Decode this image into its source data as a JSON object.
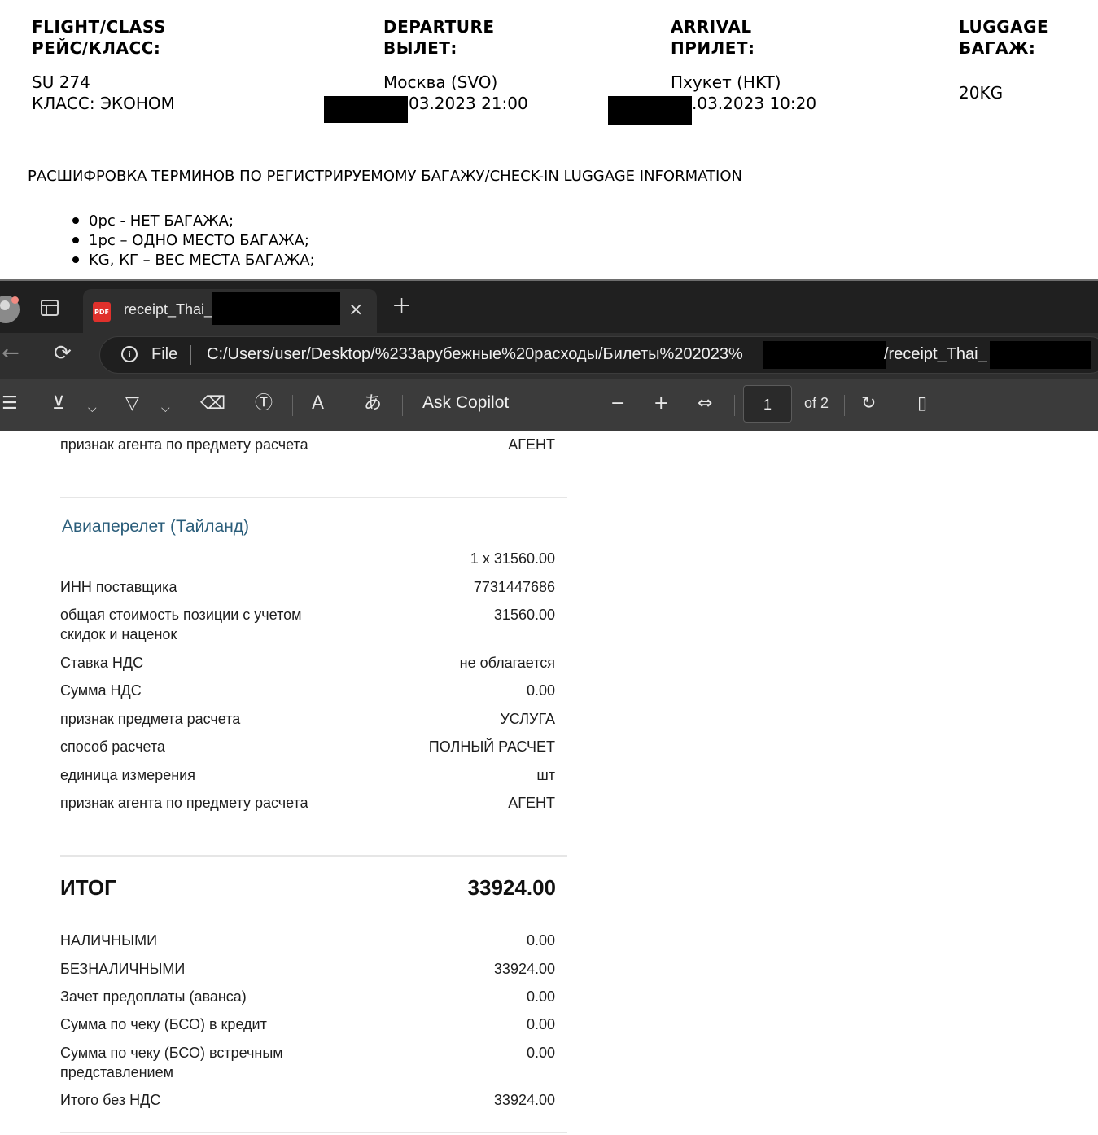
{
  "ticket": {
    "flight": {
      "header_en": "FLIGHT/CLASS",
      "header_ru": "РЕЙС/КЛАСС:",
      "line1": "SU 274",
      "line2": "КЛАСС: ЭКОНОМ"
    },
    "departure": {
      "header_en": "DEPARTURE",
      "header_ru": "ВЫЛЕТ:",
      "line1": "Москва (SVO)",
      "line2": "03.2023 21:00"
    },
    "arrival": {
      "header_en": "ARRIVAL",
      "header_ru": "ПРИЛЕТ:",
      "line1": "Пхукет (HKT)",
      "line2": ".03.2023 10:20"
    },
    "luggage": {
      "header_en": "LUGGAGE",
      "header_ru": "БАГАЖ:",
      "value": "20KG"
    },
    "terms_title": "РАСШИФРОВКА ТЕРМИНОВ ПО РЕГИСТРИРУЕМОМУ БАГАЖУ/CHECK-IN LUGGAGE INFORMATION",
    "terms": [
      "0pc - НЕТ БАГАЖА;",
      "1pc – ОДНО МЕСТО БАГАЖА;",
      "KG, КГ – ВЕС МЕСТА БАГАЖА;"
    ]
  },
  "browser": {
    "tab_title": "receipt_Thai_S",
    "address_scheme": "File",
    "address_url": "C:/Users/user/Desktop/%233арубежные%20расходы/Билеты%202023%",
    "address_url_tail": "/receipt_Thai_",
    "icons": {
      "close": "×",
      "new_tab": "+",
      "back": "←",
      "reload": "⟳",
      "info": "i",
      "menu": "☰",
      "highlight": "⊻",
      "draw": "▽",
      "dropdown": "⌵",
      "eraser": "⌫",
      "text_box": "Ⓣ",
      "read_aloud": "A",
      "translate": "あ",
      "zoom_out": "−",
      "zoom_in": "+",
      "fit_width": "⇔",
      "rotate": "↻",
      "page_view": "▯"
    }
  },
  "pdf_toolbar": {
    "ask_copilot": "Ask Copilot",
    "page_current": "1",
    "page_of": "of 2"
  },
  "receipt": {
    "top_row": {
      "label": "признак агента по предмету расчета",
      "value": "АГЕНТ"
    },
    "section_title": "Авиаперелет (Тайланд)",
    "quantity_price": "1 x 31560.00",
    "rows": [
      {
        "label": "ИНН поставщика",
        "value": "7731447686"
      },
      {
        "label": "общая стоимость позиции с учетом скидок и наценок",
        "value": "31560.00"
      },
      {
        "label": "Ставка НДС",
        "value": "не облагается"
      },
      {
        "label": "Сумма НДС",
        "value": "0.00"
      },
      {
        "label": "признак предмета расчета",
        "value": "УСЛУГА"
      },
      {
        "label": "способ расчета",
        "value": "ПОЛНЫЙ РАСЧЕТ"
      },
      {
        "label": "единица измерения",
        "value": "шт"
      },
      {
        "label": "признак агента по предмету расчета",
        "value": "АГЕНТ"
      }
    ],
    "total_label": "ИТОГ",
    "total_value": "33924.00",
    "payments": [
      {
        "label": "НАЛИЧНЫМИ",
        "value": "0.00"
      },
      {
        "label": "БЕЗНАЛИЧНЫМИ",
        "value": "33924.00"
      },
      {
        "label": "Зачет предоплаты (аванса)",
        "value": "0.00"
      },
      {
        "label": "Сумма по чеку (БСО) в кредит",
        "value": "0.00"
      },
      {
        "label": "Сумма по чеку (БСО) встречным представлением",
        "value": "0.00"
      },
      {
        "label": "Итого без НДС",
        "value": "33924.00"
      }
    ]
  }
}
